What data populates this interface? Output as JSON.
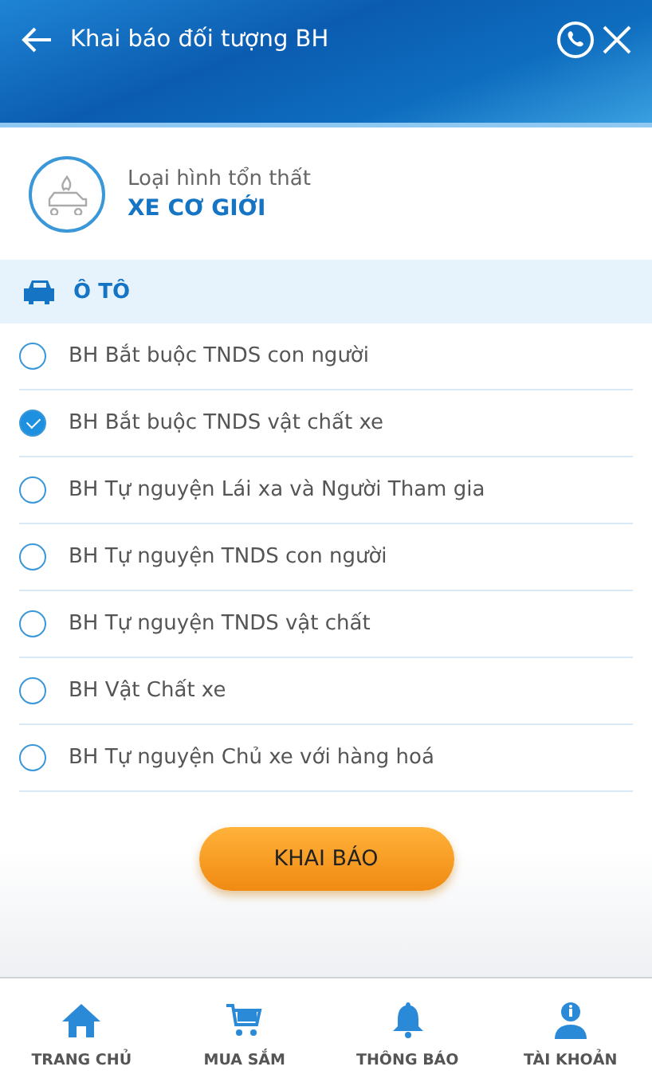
{
  "header": {
    "title": "Khai báo đối tượng BH"
  },
  "loss_type": {
    "label": "Loại hình tổn thất",
    "value": "XE CƠ GIỚI"
  },
  "category": {
    "title": "Ô TÔ"
  },
  "options": [
    {
      "label": "BH Bắt buộc TNDS con người",
      "selected": false
    },
    {
      "label": "BH Bắt buộc TNDS vật chất xe",
      "selected": true
    },
    {
      "label": "BH Tự nguyện Lái xa và Người Tham gia",
      "selected": false
    },
    {
      "label": "BH Tự nguyện TNDS con người",
      "selected": false
    },
    {
      "label": "BH Tự nguyện TNDS vật chất",
      "selected": false
    },
    {
      "label": "BH Vật Chất xe",
      "selected": false
    },
    {
      "label": "BH Tự nguyện Chủ xe với hàng hoá",
      "selected": false
    }
  ],
  "submit_button": "KHAI BÁO",
  "bottom_nav": [
    {
      "kind": "home",
      "label": "TRANG CHỦ"
    },
    {
      "kind": "cart",
      "label": "MUA SẮM"
    },
    {
      "kind": "bell",
      "label": "THÔNG BÁO"
    },
    {
      "kind": "account",
      "label": "TÀI KHOẢN"
    }
  ]
}
